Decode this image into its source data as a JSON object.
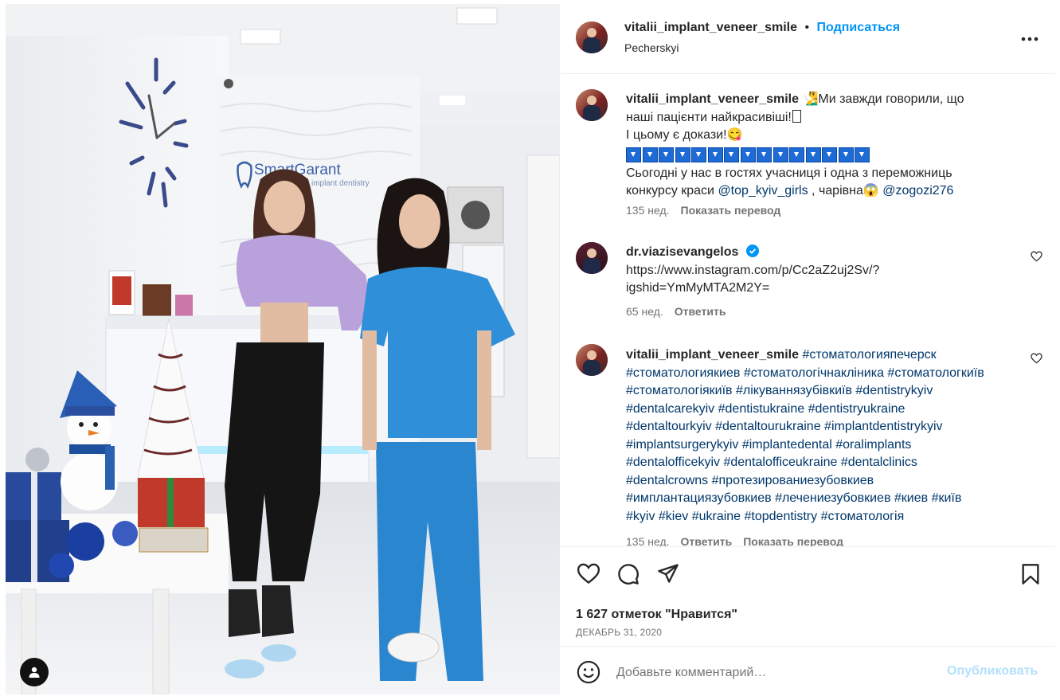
{
  "post_header": {
    "username": "vitalii_implant_veneer_smile",
    "separator": "•",
    "follow_label": "Подписаться",
    "location": "Pecherskyi",
    "more_icon": "more-horizontal-icon"
  },
  "caption": {
    "username": "vitalii_implant_veneer_smile",
    "line1_emoji": "🧏‍♂",
    "line1_text": "Ми завжди говорили, що",
    "line2": "наші пацієнти найкрасивіші!",
    "line2_suffix": "",
    "line3": "І цьому є докази!",
    "line3_emoji": "😋",
    "arrow_count_label": "⏬⏬⏬⏬⏬⏬⏬⏬⏬⏬⏬⏬⏬⏬⏬",
    "line5": "Сьогодні у нас в гостях учасниця і одна з переможниць",
    "line6_prefix": "конкурсу краси ",
    "mention1": "@top_kyiv_girls",
    "line6_mid": " , чарівна",
    "line6_emoji": "😱",
    "mention2": "@zogozi276",
    "time": "135 нед.",
    "translate": "Показать перевод"
  },
  "comment1": {
    "username": "dr.viazisevangelos",
    "verified": true,
    "text_line1": "https://www.instagram.com/p/Cc2aZ2uj2Sv/?",
    "text_line2": "igshid=YmMyMTA2M2Y=",
    "time": "65 нед.",
    "reply": "Ответить"
  },
  "comment2": {
    "username": "vitalii_implant_veneer_smile",
    "tags_line1": "#стоматологияпечерск",
    "tags_lines": [
      "#стоматологиякиев #стоматологічнакліника #стоматологкиїв",
      "#стоматологіякиїв #лікуваннязубівкиїв #dentistrykyiv",
      "#dentalcarekyiv #dentistukraine #dentistryukraine",
      "#dentaltourkyiv #dentaltourukraine #implantdentistrykyiv",
      "#implantsurgerykyiv #implantedental #oralimplants",
      "#dentalofficekyiv #dentalofficeukraine #dentalclinics",
      "#dentalcrowns #протезированиезубовкиев",
      "#имплантациязубовкиев #лечениезубовкиев #киев #київ",
      "#kyiv #kiev #ukraine #topdentistry #стоматологія"
    ],
    "time": "135 нед.",
    "reply": "Ответить",
    "translate": "Показать перевод"
  },
  "actions": {
    "likes": "1 627 отметок \"Нравится\"",
    "date": "ДЕКАБРЬ 31, 2020",
    "like_icon": "heart-icon",
    "comment_icon": "comment-icon",
    "share_icon": "share-icon",
    "save_icon": "bookmark-icon"
  },
  "add_comment": {
    "placeholder": "Добавьте комментарий…",
    "publish": "Опубликовать",
    "emoji_icon": "emoji-icon"
  },
  "photo": {
    "sign_text": "SmartGarant",
    "sign_sub": "implant dentistry",
    "user_tag_icon": "person-icon"
  },
  "colors": {
    "link": "#00376b",
    "follow": "#0095f6",
    "publish_disabled": "#b2dffc",
    "muted": "#737373"
  }
}
